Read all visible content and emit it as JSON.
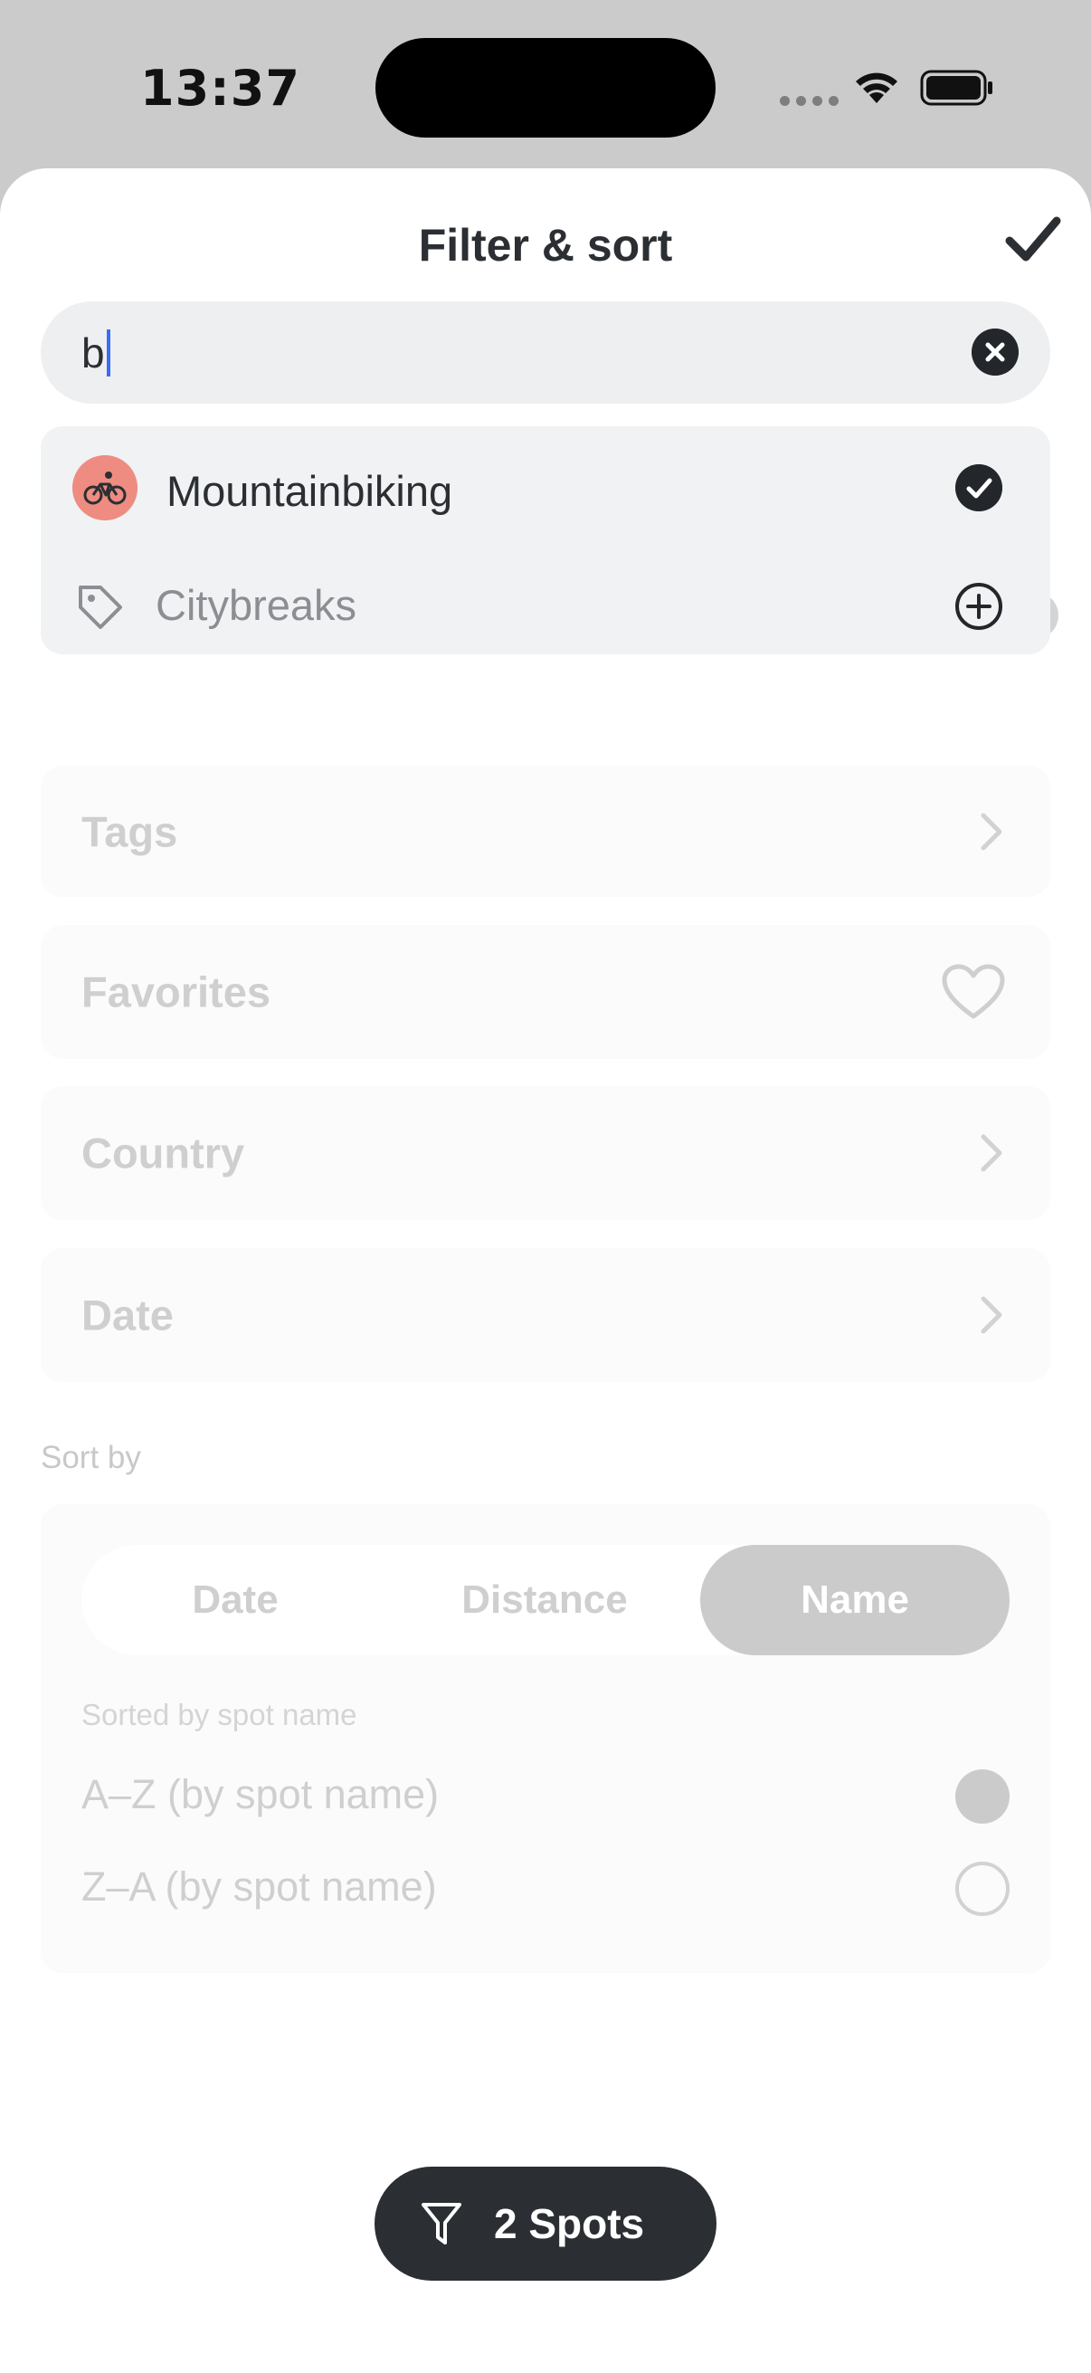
{
  "status_bar": {
    "time": "13:37"
  },
  "sheet": {
    "title": "Filter & sort",
    "search": {
      "value": "b"
    },
    "suggestions": [
      {
        "label": "Mountainbiking",
        "state": "selected",
        "icon": "bike-icon"
      },
      {
        "label": "Citybreaks",
        "state": "add",
        "icon": "tag-icon"
      }
    ],
    "filters": {
      "tags": "Tags",
      "favorites": "Favorites",
      "country": "Country",
      "date": "Date"
    },
    "sort": {
      "caption": "Sort by",
      "segments": [
        "Date",
        "Distance",
        "Name"
      ],
      "selected_segment": "Name",
      "subtitle": "Sorted by spot name",
      "options": [
        {
          "label": "A–Z (by spot name)",
          "selected": true
        },
        {
          "label": "Z–A (by spot name)",
          "selected": false
        }
      ]
    },
    "result_button": {
      "label": "2 Spots"
    }
  },
  "colors": {
    "primary_dark": "#2b2f33",
    "avatar_salmon": "#ee8c82",
    "caret_blue": "#3b6cf6"
  }
}
